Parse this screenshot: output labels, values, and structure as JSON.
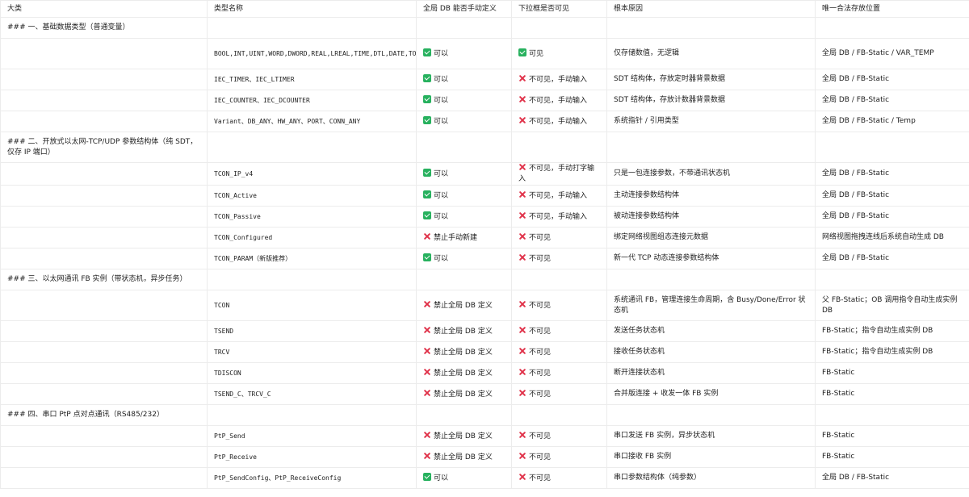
{
  "columns": [
    "大类",
    "类型名称",
    "全局 DB 能否手动定义",
    "下拉框是否可见",
    "根本原因",
    "唯一合法存放位置"
  ],
  "status_icons": {
    "check": "green-check-icon",
    "cross": "red-cross-icon",
    "check_color": "#27b15e",
    "cross_color": "#e0324a"
  },
  "sections": [
    {
      "title": "### 一、基础数据类型（普通变量）",
      "rows": [
        {
          "type": "BOOL,INT,UINT,WORD,DWORD,REAL,LREAL,TIME,DTL,DATE,TOD",
          "db_icon": "check",
          "db": "可以",
          "dd_icon": "check",
          "dd": "可见",
          "reason": "仅存储数值，无逻辑",
          "location": "全局 DB / FB-Static / VAR_TEMP"
        },
        {
          "type": "IEC_TIMER、IEC_LTIMER",
          "db_icon": "check",
          "db": "可以",
          "dd_icon": "cross",
          "dd": "不可见，手动输入",
          "reason": "SDT 结构体，存放定时器背景数据",
          "location": "全局 DB / FB-Static"
        },
        {
          "type": "IEC_COUNTER、IEC_DCOUNTER",
          "db_icon": "check",
          "db": "可以",
          "dd_icon": "cross",
          "dd": "不可见，手动输入",
          "reason": "SDT 结构体，存放计数器背景数据",
          "location": "全局 DB / FB-Static"
        },
        {
          "type": "Variant、DB_ANY、HW_ANY、PORT、CONN_ANY",
          "db_icon": "check",
          "db": "可以",
          "dd_icon": "cross",
          "dd": "不可见，手动输入",
          "reason": "系统指针 / 引用类型",
          "location": "全局 DB / FB-Static / Temp"
        }
      ]
    },
    {
      "title": "### 二、开放式以太网-TCP/UDP 参数结构体（纯 SDT，仅存 IP 端口）",
      "rows": [
        {
          "type": "TCON_IP_v4",
          "db_icon": "check",
          "db": "可以",
          "dd_icon": "cross",
          "dd": "不可见，手动打字输入",
          "reason": "只是一包连接参数，不带通讯状态机",
          "location": "全局 DB / FB-Static"
        },
        {
          "type": "TCON_Active",
          "db_icon": "check",
          "db": "可以",
          "dd_icon": "cross",
          "dd": "不可见，手动输入",
          "reason": "主动连接参数结构体",
          "location": "全局 DB / FB-Static"
        },
        {
          "type": "TCON_Passive",
          "db_icon": "check",
          "db": "可以",
          "dd_icon": "cross",
          "dd": "不可见，手动输入",
          "reason": "被动连接参数结构体",
          "location": "全局 DB / FB-Static"
        },
        {
          "type": "TCON_Configured",
          "db_icon": "cross",
          "db": "禁止手动新建",
          "dd_icon": "cross",
          "dd": "不可见",
          "reason": "绑定网络视图组态连接元数据",
          "location": "网络视图拖拽连线后系统自动生成 DB"
        },
        {
          "type": "TCON_PARAM（新版推荐）",
          "db_icon": "check",
          "db": "可以",
          "dd_icon": "cross",
          "dd": "不可见",
          "reason": "新一代 TCP 动态连接参数结构体",
          "location": "全局 DB / FB-Static"
        }
      ]
    },
    {
      "title": "### 三、以太网通讯 FB 实例（带状态机，异步任务）",
      "rows": [
        {
          "type": "TCON",
          "db_icon": "cross",
          "db": "禁止全局 DB 定义",
          "dd_icon": "cross",
          "dd": "不可见",
          "reason": "系统通讯 FB，管理连接生命周期，含 Busy/Done/Error 状态机",
          "location": "父 FB-Static；OB 调用指令自动生成实例 DB",
          "tall": true
        },
        {
          "type": "TSEND",
          "db_icon": "cross",
          "db": "禁止全局 DB 定义",
          "dd_icon": "cross",
          "dd": "不可见",
          "reason": "发送任务状态机",
          "location": "FB-Static；指令自动生成实例 DB"
        },
        {
          "type": "TRCV",
          "db_icon": "cross",
          "db": "禁止全局 DB 定义",
          "dd_icon": "cross",
          "dd": "不可见",
          "reason": "接收任务状态机",
          "location": "FB-Static；指令自动生成实例 DB"
        },
        {
          "type": "TDISCON",
          "db_icon": "cross",
          "db": "禁止全局 DB 定义",
          "dd_icon": "cross",
          "dd": "不可见",
          "reason": "断开连接状态机",
          "location": "FB-Static"
        },
        {
          "type": "TSEND_C、TRCV_C",
          "db_icon": "cross",
          "db": "禁止全局 DB 定义",
          "dd_icon": "cross",
          "dd": "不可见",
          "reason": "合并版连接 + 收发一体 FB 实例",
          "location": "FB-Static"
        }
      ]
    },
    {
      "title": "### 四、串口 PtP 点对点通讯（RS485/232）",
      "rows": [
        {
          "type": "PtP_Send",
          "db_icon": "cross",
          "db": "禁止全局 DB 定义",
          "dd_icon": "cross",
          "dd": "不可见",
          "reason": "串口发送 FB 实例，异步状态机",
          "location": "FB-Static"
        },
        {
          "type": "PtP_Receive",
          "db_icon": "cross",
          "db": "禁止全局 DB 定义",
          "dd_icon": "cross",
          "dd": "不可见",
          "reason": "串口接收 FB 实例",
          "location": "FB-Static"
        },
        {
          "type": "PtP_SendConfig、PtP_ReceiveConfig",
          "db_icon": "check",
          "db": "可以",
          "dd_icon": "cross",
          "dd": "不可见",
          "reason": "串口参数结构体（纯参数）",
          "location": "全局 DB / FB-Static"
        }
      ]
    }
  ]
}
